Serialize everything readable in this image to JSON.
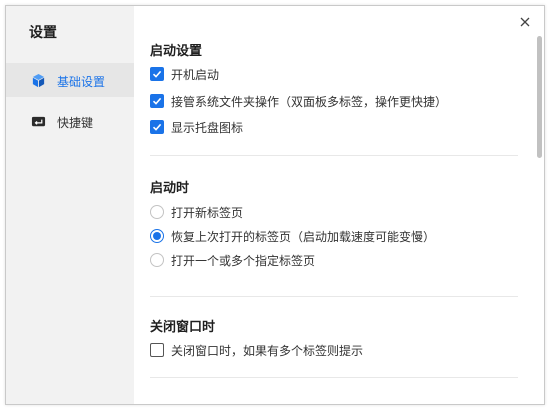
{
  "dialog": {
    "title": "设置"
  },
  "sidebar": {
    "items": [
      {
        "label": "基础设置",
        "icon": "cube-icon",
        "active": true
      },
      {
        "label": "快捷键",
        "icon": "keyboard-icon",
        "active": false
      }
    ]
  },
  "sections": {
    "startup": {
      "title": "启动设置",
      "options": [
        {
          "label": "开机启动",
          "checked": true
        },
        {
          "label": "接管系统文件夹操作（双面板多标签，操作更快捷）",
          "checked": true
        },
        {
          "label": "显示托盘图标",
          "checked": true
        }
      ]
    },
    "on_start": {
      "title": "启动时",
      "options": [
        {
          "label": "打开新标签页",
          "selected": false
        },
        {
          "label": "恢复上次打开的标签页（启动加载速度可能变慢）",
          "selected": true
        },
        {
          "label": "打开一个或多个指定标签页",
          "selected": false
        }
      ]
    },
    "on_close": {
      "title": "关闭窗口时",
      "options": [
        {
          "label": "关闭窗口时，如果有多个标签则提示",
          "checked": false
        }
      ]
    }
  },
  "colors": {
    "accent": "#1a73e8",
    "sidebar_bg": "#f2f2f2",
    "active_item_bg": "#e6e6e6"
  }
}
